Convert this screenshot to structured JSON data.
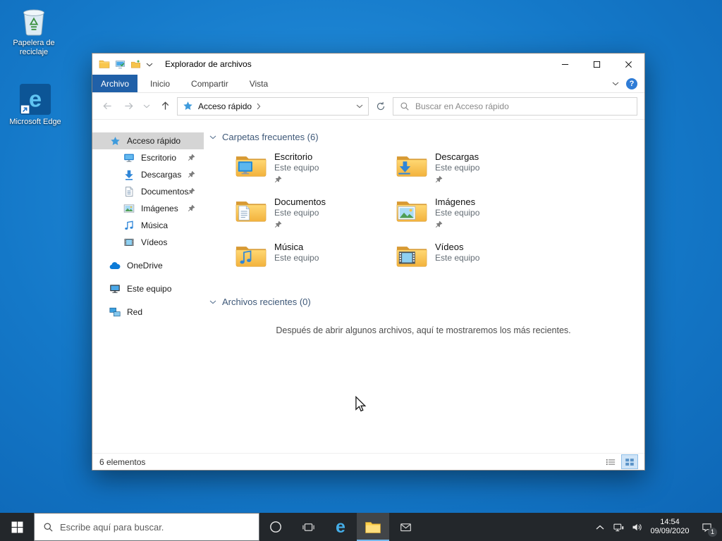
{
  "desktop": {
    "icons": [
      {
        "id": "recycle-bin",
        "label": "Papelera de reciclaje"
      },
      {
        "id": "microsoft-edge",
        "label": "Microsoft Edge",
        "glyph": "e"
      }
    ]
  },
  "explorer": {
    "window_title": "Explorador de archivos",
    "ribbon": {
      "tabs": [
        {
          "id": "archivo",
          "label": "Archivo",
          "active": true
        },
        {
          "id": "inicio",
          "label": "Inicio",
          "active": false
        },
        {
          "id": "compartir",
          "label": "Compartir",
          "active": false
        },
        {
          "id": "vista",
          "label": "Vista",
          "active": false
        }
      ],
      "help_glyph": "?"
    },
    "navbar": {
      "address_location": "Acceso rápido",
      "search_placeholder": "Buscar en Acceso rápido"
    },
    "sidebar": {
      "items": [
        {
          "id": "acceso-rapido",
          "label": "Acceso rápido",
          "icon": "star",
          "level": 0,
          "selected": true,
          "pinned": false,
          "group": false
        },
        {
          "id": "escritorio",
          "label": "Escritorio",
          "icon": "desktop",
          "level": 1,
          "selected": false,
          "pinned": true,
          "group": false
        },
        {
          "id": "descargas",
          "label": "Descargas",
          "icon": "downloads",
          "level": 1,
          "selected": false,
          "pinned": true,
          "group": false
        },
        {
          "id": "documentos",
          "label": "Documentos",
          "icon": "documents",
          "level": 1,
          "selected": false,
          "pinned": true,
          "group": false
        },
        {
          "id": "imagenes",
          "label": "Imágenes",
          "icon": "pictures",
          "level": 1,
          "selected": false,
          "pinned": true,
          "group": false
        },
        {
          "id": "musica",
          "label": "Música",
          "icon": "music",
          "level": 1,
          "selected": false,
          "pinned": false,
          "group": false
        },
        {
          "id": "videos",
          "label": "Vídeos",
          "icon": "videos",
          "level": 1,
          "selected": false,
          "pinned": false,
          "group": false
        },
        {
          "id": "onedrive",
          "label": "OneDrive",
          "icon": "onedrive",
          "level": 0,
          "selected": false,
          "pinned": false,
          "group": true
        },
        {
          "id": "este-equipo",
          "label": "Este equipo",
          "icon": "computer",
          "level": 0,
          "selected": false,
          "pinned": false,
          "group": true
        },
        {
          "id": "red",
          "label": "Red",
          "icon": "network",
          "level": 0,
          "selected": false,
          "pinned": false,
          "group": true
        }
      ]
    },
    "content": {
      "sections": [
        {
          "id": "frequent",
          "title": "Carpetas frecuentes (6)"
        },
        {
          "id": "recent",
          "title": "Archivos recientes (0)"
        }
      ],
      "folders": [
        {
          "name": "Escritorio",
          "location": "Este equipo",
          "icon": "desktop",
          "pinned": true
        },
        {
          "name": "Descargas",
          "location": "Este equipo",
          "icon": "downloads",
          "pinned": true
        },
        {
          "name": "Documentos",
          "location": "Este equipo",
          "icon": "documents",
          "pinned": true
        },
        {
          "name": "Imágenes",
          "location": "Este equipo",
          "icon": "pictures",
          "pinned": true
        },
        {
          "name": "Música",
          "location": "Este equipo",
          "icon": "music",
          "pinned": false
        },
        {
          "name": "Vídeos",
          "location": "Este equipo",
          "icon": "videos",
          "pinned": false
        }
      ],
      "recent_empty_message": "Después de abrir algunos archivos, aquí te mostraremos los más recientes.",
      "status_left": "6 elementos"
    }
  },
  "taskbar": {
    "search_placeholder": "Escribe aquí para buscar.",
    "edge_glyph": "e",
    "clock": {
      "time": "14:54",
      "date": "09/09/2020"
    },
    "notification_badge": "1"
  },
  "colors": {
    "accent": "#0078d7",
    "ribbon_file_tab": "#2060a8",
    "folder_yellow": "#f6bd43",
    "sidebar_selected": "#d5d5d5",
    "taskbar_bg": "#23272b",
    "desktop_blue": "#1478c8"
  }
}
